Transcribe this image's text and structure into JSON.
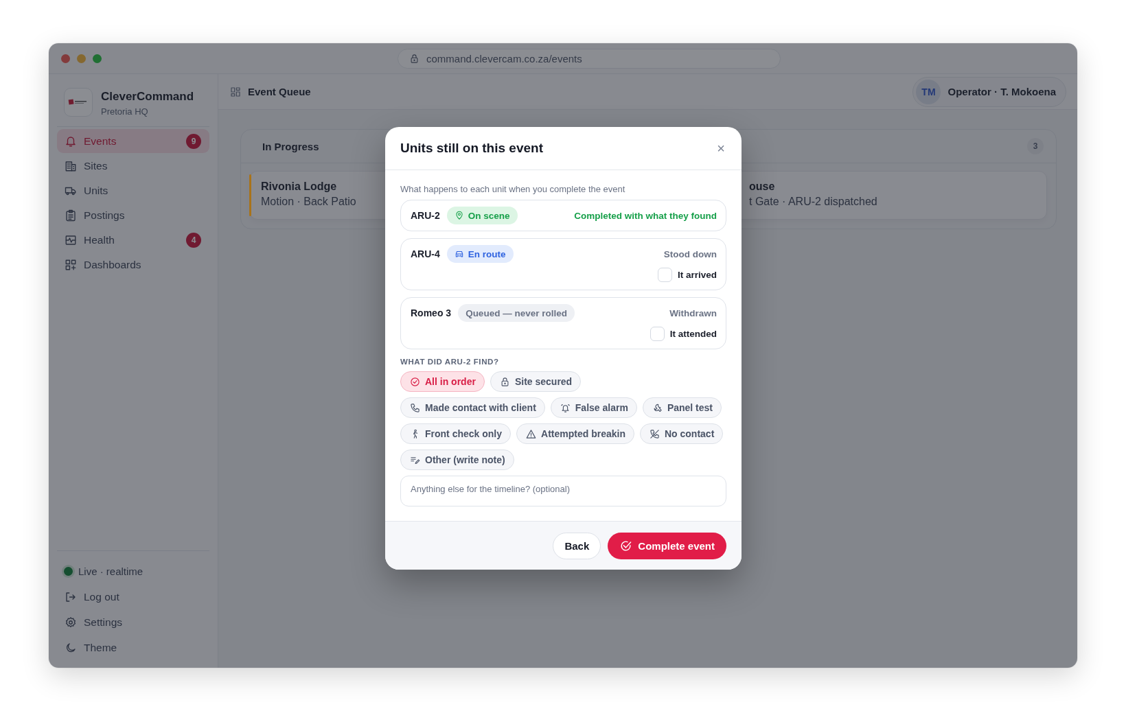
{
  "window": {
    "url": "command.clevercam.co.za/events"
  },
  "sidebar": {
    "brand": {
      "name": "CleverCommand",
      "location": "Pretoria HQ"
    },
    "nav": [
      {
        "label": "Events",
        "badge": "9",
        "selected": true
      },
      {
        "label": "Sites",
        "selected": false
      },
      {
        "label": "Units",
        "selected": false
      },
      {
        "label": "Postings",
        "selected": false
      },
      {
        "label": "Health",
        "badge": "4",
        "selected": false
      },
      {
        "label": "Dashboards",
        "selected": false
      }
    ],
    "status": {
      "label": "Live · realtime",
      "on": true
    },
    "footer_items": [
      {
        "label": "Log out"
      },
      {
        "label": "Settings"
      },
      {
        "label": "Theme"
      }
    ]
  },
  "header": {
    "title": "Event Queue",
    "user": {
      "initials": "TM",
      "label": "Operator · T. Mokoena"
    }
  },
  "board": {
    "column": {
      "title": "In Progress",
      "count": "3",
      "cards": [
        {
          "title": "Rivonia Lodge",
          "subtitle": "Motion · Back Patio",
          "color": "#a8731a"
        },
        {
          "title": "ouse",
          "subtitle": "t Gate · ARU-2 dispatched"
        }
      ]
    }
  },
  "modal": {
    "title": "Units still on this event",
    "close": "×",
    "subtitle": "What happens to each unit when you complete the event",
    "units": [
      {
        "name": "ARU-2",
        "status": {
          "kind": "on_scene",
          "label": "On scene"
        },
        "kind": "complete",
        "outcome": "Completed with what they found"
      },
      {
        "name": "ARU-4",
        "status": {
          "kind": "en_route",
          "label": "En route"
        },
        "kind": "pending",
        "outcome": "Stood down",
        "check": {
          "label": "It arrived",
          "checked": false
        }
      },
      {
        "name": "Romeo 3",
        "status": {
          "kind": "queued",
          "label": "Queued — never rolled"
        },
        "kind": "pending",
        "outcome": "Withdrawn",
        "check": {
          "label": "It attended",
          "checked": false
        }
      }
    ],
    "findings_label": "WHAT DID ARU-2 FIND?",
    "findings": [
      {
        "label": "All in order",
        "selected": true
      },
      {
        "label": "Site secured",
        "selected": false
      },
      {
        "label": "Made contact with client",
        "selected": false
      },
      {
        "label": "False alarm",
        "selected": false
      },
      {
        "label": "Panel test",
        "selected": false
      },
      {
        "label": "Front check only",
        "selected": false
      },
      {
        "label": "Attempted breakin",
        "selected": false
      },
      {
        "label": "No contact",
        "selected": false
      },
      {
        "label": "Other (write note)",
        "selected": false
      }
    ],
    "note": {
      "placeholder": "Anything else for the timeline? (optional)"
    },
    "buttons": {
      "back": "Back",
      "complete": "Complete event"
    }
  }
}
